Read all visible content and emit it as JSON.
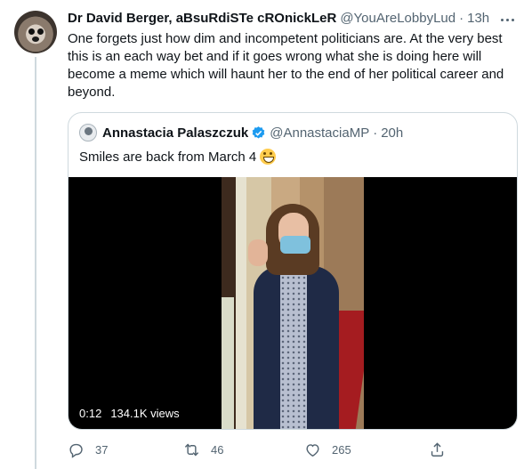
{
  "tweet": {
    "display_name": "Dr David Berger, aBsuRdiSTe cROnickLeR",
    "handle": "@YouAreLobbyLud",
    "dot": "·",
    "time": "13h",
    "text": "One forgets just how dim and incompetent politicians are. At the very best this is an each way bet and if it goes wrong what she is doing here will become a meme which will haunt her to the end of her political career and beyond.",
    "avatar_icon": "dog-avatar"
  },
  "quote": {
    "display_name": "Annastacia Palaszczuk",
    "handle": "@AnnastaciaMP",
    "dot": "·",
    "time": "20h",
    "text": "Smiles are back from March 4",
    "emoji": "grinning-face-emoji",
    "verified_color": "#1d9bf0",
    "video": {
      "duration": "0:12",
      "views": "134.1K views"
    }
  },
  "actions": {
    "reply_count": "37",
    "retweet_count": "46",
    "like_count": "265"
  }
}
